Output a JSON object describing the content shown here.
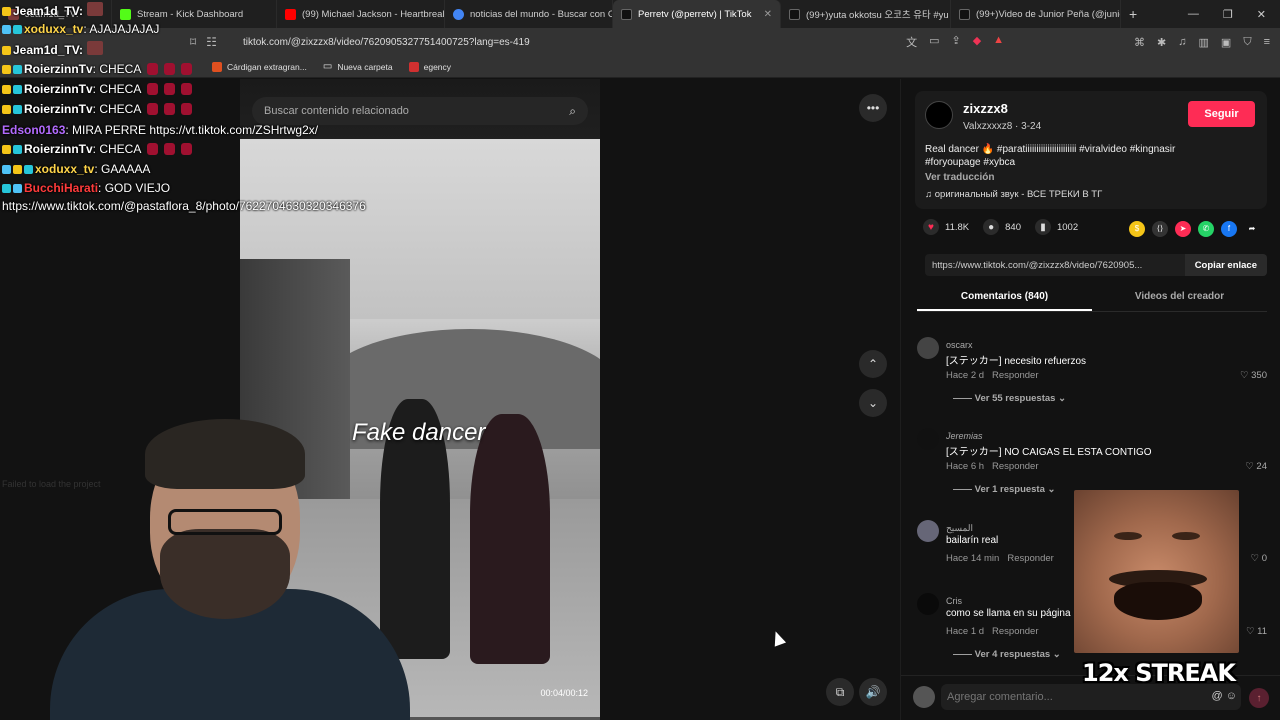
{
  "tabs": [
    {
      "label": "Jeam1d_TV:",
      "color": "#7a3a3a"
    },
    {
      "label": "Stream - Kick Dashboard",
      "color": "#53fc18"
    },
    {
      "label": "(99) Michael Jackson - Heartbreak H",
      "color": "#ff0000"
    },
    {
      "label": "noticias del mundo - Buscar con Go",
      "color": "#4285f4"
    },
    {
      "label": "Perretv (@perretv) | TikTok",
      "color": "#111111",
      "active": true
    },
    {
      "label": "(99+)yuta okkotsu 오코츠 유타 #yu",
      "color": "#111111"
    },
    {
      "label": "(99+)Video de Junior Peña (@junior",
      "color": "#111111"
    }
  ],
  "address": {
    "url": "tiktok.com/@zixzzx8/video/7620905327751400725?lang=es-419"
  },
  "bookmarks": [
    {
      "label": "Cárdigan extragran...",
      "color": "#e05020"
    },
    {
      "label": "Nueva carpeta",
      "color": "#aaaaaa"
    },
    {
      "label": "egency",
      "color": "#d03030"
    }
  ],
  "chat": [
    {
      "user": "Jeam1d_TV:",
      "text": "",
      "color": "#ffffff"
    },
    {
      "user": "xoduxx_tv",
      "text": ": AJAJAJAJAJ",
      "color": "#ffd54a"
    },
    {
      "user": "Jeam1d_TV:",
      "text": "",
      "color": "#ffffff"
    },
    {
      "user": "RoierzinnTv",
      "text": ": CHECA",
      "color": "#ffffff"
    },
    {
      "user": "RoierzinnTv",
      "text": ": CHECA",
      "color": "#ffffff"
    },
    {
      "user": "RoierzinnTv",
      "text": ": CHECA",
      "color": "#ffffff"
    },
    {
      "user": "Edson0163",
      "text": ": MIRA PERRE https://vt.tiktok.com/ZSHrtwg2x/",
      "color": "#b36bff"
    },
    {
      "user": "RoierzinnTv",
      "text": ": CHECA",
      "color": "#ffffff"
    },
    {
      "user": "xoduxx_tv",
      "text": ": GAAAAA",
      "color": "#ffd54a"
    },
    {
      "user": "BucchiHarati",
      "text": ": GOD VIEJO",
      "color": "#ff3b3b"
    },
    {
      "user": "",
      "text": "https://www.tiktok.com/@pastaflora_8/photo/7622704630320346376",
      "color": "#ffffff"
    }
  ],
  "faded_error": "Failed to load the project",
  "video": {
    "search_placeholder": "Buscar contenido relacionado",
    "caption": "Fake dancer",
    "time": "00:04/00:12",
    "progress_fraction": 0.33
  },
  "profile": {
    "name": "zixzzx8",
    "handle": "Valxzxxxz8 · 3-24",
    "follow_label": "Seguir",
    "description": "Real dancer 🔥 #paratiiiiiiiiiiiiiiiiiiiiiii #viralvideo #kingnasir #foryoupage #xybca",
    "translate_label": "Ver traducción",
    "sound": "♫ оригинальный звук - ВСЕ ТРЕКИ В ТГ"
  },
  "stats": {
    "likes": "11.8K",
    "comments": "840",
    "saves": "1002"
  },
  "link": {
    "url": "https://www.tiktok.com/@zixzzx8/video/7620905...",
    "copy_label": "Copiar enlace"
  },
  "panel_tabs": [
    {
      "label": "Comentarios (840)",
      "active": true
    },
    {
      "label": "Videos del creador",
      "active": false
    }
  ],
  "comments": [
    {
      "user": "oscarx",
      "text": "[ステッカー] necesito refuerzos",
      "time": "Hace 2 d",
      "reply": "Responder",
      "likes": "350",
      "more": "Ver 55 respuestas"
    },
    {
      "user": "Jeremias",
      "text": "[ステッカー] NO CAIGAS EL ESTA CONTIGO",
      "time": "Hace 6 h",
      "reply": "Responder",
      "likes": "24",
      "more": "Ver 1 respuesta"
    },
    {
      "user": "المسيح",
      "text": "bailarín real",
      "time": "Hace 14 min",
      "reply": "Responder",
      "likes": "0",
      "more": ""
    },
    {
      "user": "Cris",
      "text": "como se llama en su página",
      "time": "Hace 1 d",
      "reply": "Responder",
      "likes": "11",
      "more": "Ver 4 respuestas"
    }
  ],
  "comment_input": {
    "placeholder": "Agregar comentario..."
  },
  "overlay": {
    "streak": "12x STREAK"
  }
}
